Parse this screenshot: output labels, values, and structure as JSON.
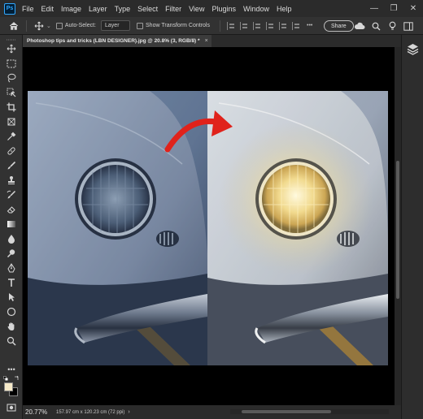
{
  "app": {
    "logo_text": "Ps",
    "menu": [
      "File",
      "Edit",
      "Image",
      "Layer",
      "Type",
      "Select",
      "Filter",
      "View",
      "Plugins",
      "Window",
      "Help"
    ]
  },
  "window_controls": {
    "minimize": "—",
    "restore": "❐",
    "close": "✕"
  },
  "options_bar": {
    "auto_select_label": "Auto-Select:",
    "auto_select_value": "Layer",
    "show_transform_label": "Show Transform Controls",
    "share_label": "Share",
    "more_label": "•••"
  },
  "document": {
    "tab_title": "Photoshop tips and tricks (LBN DESIGNER).jpg @ 20.8% (3, RGB/8) *",
    "close_glyph": "×"
  },
  "status": {
    "zoom": "20.77%",
    "doc_info": "157.97 cm x 120.23 cm (72 ppi)",
    "arrow": "›"
  },
  "colors": {
    "foreground": "#f5e9c8",
    "background": "#000000",
    "accent": "#31a8ff",
    "arrow_red": "#e0221b"
  },
  "tools": [
    "move-tool",
    "marquee-tool",
    "lasso-tool",
    "object-select-tool",
    "crop-tool",
    "frame-tool",
    "eyedropper-tool",
    "spot-healing-tool",
    "brush-tool",
    "clone-stamp-tool",
    "history-brush-tool",
    "eraser-tool",
    "gradient-tool",
    "blur-tool",
    "dodge-tool",
    "pen-tool",
    "type-tool",
    "path-select-tool",
    "shape-tool",
    "hand-tool",
    "zoom-tool",
    "more-tools"
  ]
}
